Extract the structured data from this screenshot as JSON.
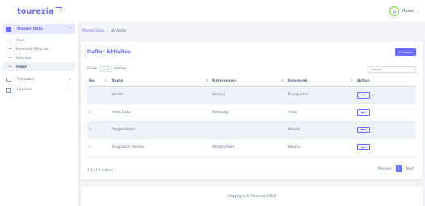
{
  "brand": {
    "name": "tourezia"
  },
  "sidebar": {
    "master": {
      "label": "Master Data",
      "items": [
        {
          "label": "Akun"
        },
        {
          "label": "Kelompok Aktivitas"
        },
        {
          "label": "Aktivitas"
        },
        {
          "label": "Paket"
        }
      ]
    },
    "transaksi": {
      "label": "Transaksi"
    },
    "laporan": {
      "label": "Laporan"
    }
  },
  "topbar": {
    "user_name": "Mawar"
  },
  "breadcrumb": {
    "parent": "Master Data",
    "separator": "/",
    "current": "Aktivitas"
  },
  "card": {
    "title": "Daftar Aktivitas",
    "add_button": "+ Tambah",
    "show_label": "Show",
    "page_size": "10",
    "entries_label": "entries",
    "search_placeholder": "Search"
  },
  "table": {
    "headers": [
      "No",
      "Nama",
      "Keterangan",
      "Kelompok",
      "Action"
    ],
    "rows": [
      {
        "no": "1",
        "nama": "Kereta",
        "keterangan": "Serayu",
        "kelompok": "Transportasi"
      },
      {
        "no": "2",
        "nama": "Hotel Batu",
        "keterangan": "Bandung",
        "kelompok": "Hotel"
      },
      {
        "no": "3",
        "nama": "Pangandaran",
        "keterangan": "-",
        "kelompok": "Wisata"
      },
      {
        "no": "4",
        "nama": "Tangkuban Perahu",
        "keterangan": "Wisata Alam",
        "kelompok": "Wisata"
      }
    ]
  },
  "pagination": {
    "info": "1-4 of 4 entries",
    "previous": "Previous",
    "current": "1",
    "next": "Next"
  },
  "footer": {
    "text": "Copyright © Tourezia 2022"
  },
  "colors": {
    "accent": "#696cff",
    "background": "#f5f5f9",
    "row_stripe": "#eef2fa"
  }
}
